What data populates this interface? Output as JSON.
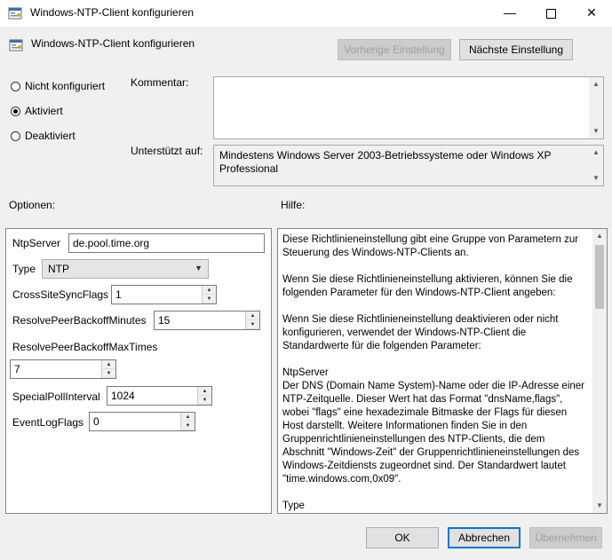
{
  "window": {
    "title": "Windows-NTP-Client konfigurieren",
    "minimize_glyph": "—",
    "close_glyph": "✕"
  },
  "header": {
    "title": "Windows-NTP-Client konfigurieren",
    "prev_button": "Vorherige Einstellung",
    "next_button": "Nächste Einstellung"
  },
  "state": {
    "options": [
      {
        "label": "Nicht konfiguriert",
        "checked": false
      },
      {
        "label": "Aktiviert",
        "checked": true
      },
      {
        "label": "Deaktiviert",
        "checked": false
      }
    ]
  },
  "comment": {
    "label": "Kommentar:",
    "value": ""
  },
  "supported": {
    "label": "Unterstützt auf:",
    "value": "Mindestens Windows Server 2003-Betriebssysteme oder Windows XP Professional"
  },
  "options_label": "Optionen:",
  "help_label": "Hilfe:",
  "fields": {
    "ntpserver_label": "NtpServer",
    "ntpserver_value": "de.pool.time.org",
    "type_label": "Type",
    "type_value": "NTP",
    "crosssite_label": "CrossSiteSyncFlags",
    "crosssite_value": "1",
    "resolvepeer_label": "ResolvePeerBackoffMinutes",
    "resolvepeer_value": "15",
    "resolvemax_label": "ResolvePeerBackoffMaxTimes",
    "resolvemax_value": "7",
    "specialpoll_label": "SpecialPollInterval",
    "specialpoll_value": "1024",
    "eventlog_label": "EventLogFlags",
    "eventlog_value": "0"
  },
  "help": {
    "p1": "Diese Richtlinieneinstellung gibt eine Gruppe von Parametern zur Steuerung des Windows-NTP-Clients an.",
    "p2": "Wenn Sie diese Richtlinieneinstellung aktivieren, können Sie die folgenden Parameter für den Windows-NTP-Client angeben:",
    "p3": "Wenn Sie diese Richtlinieneinstellung deaktivieren oder nicht konfigurieren, verwendet der Windows-NTP-Client die Standardwerte für die folgenden Parameter:",
    "p4_title": "NtpServer",
    "p4": "Der DNS (Domain Name System)-Name oder die IP-Adresse einer NTP-Zeitquelle. Dieser Wert hat das Format \"dnsName,flags\", wobei \"flags\" eine hexadezimale Bitmaske der Flags für diesen Host darstellt. Weitere Informationen finden Sie in den Gruppenrichtlinieneinstellungen des NTP-Clients, die dem Abschnitt \"Windows-Zeit\" der Gruppenrichtlinieneinstellungen des Windows-Zeitdiensts zugeordnet sind. Der Standardwert lautet \"time.windows.com,0x09\".",
    "p5": "Type"
  },
  "footer": {
    "ok": "OK",
    "cancel": "Abbrechen",
    "apply": "Übernehmen"
  }
}
